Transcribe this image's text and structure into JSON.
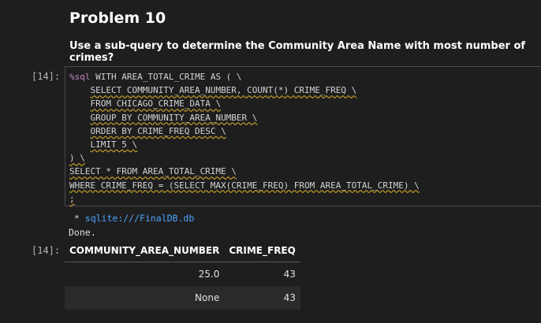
{
  "markdown": {
    "title": "Problem 10",
    "question": "Use a sub-query to determine the Community Area Name with most number of crimes?"
  },
  "cell": {
    "input_prompt": "[14]:",
    "output_prompt": "[14]:",
    "code": {
      "l1_magic": "%sql",
      "l1_rest": " WITH AREA_TOTAL_CRIME AS ( \\",
      "l2": "SELECT COMMUNITY_AREA_NUMBER, COUNT(*) CRIME_FREQ \\",
      "l3": "FROM CHICAGO_CRIME_DATA \\",
      "l4": "GROUP BY COMMUNITY_AREA_NUMBER \\",
      "l5": "ORDER BY CRIME_FREQ DESC \\",
      "l6": "LIMIT 5 \\",
      "l7": ") \\",
      "l8": "SELECT * FROM AREA_TOTAL_CRIME \\",
      "l9": "WHERE CRIME_FREQ = (SELECT MAX(CRIME_FREQ) FROM AREA_TOTAL_CRIME) \\",
      "l10": ";"
    },
    "output": {
      "star": " * ",
      "connection": "sqlite:///FinalDB.db",
      "done": "Done."
    },
    "table": {
      "headers": [
        "COMMUNITY_AREA_NUMBER",
        "CRIME_FREQ"
      ],
      "rows": [
        [
          "25.0",
          "43"
        ],
        [
          "None",
          "43"
        ]
      ]
    }
  }
}
